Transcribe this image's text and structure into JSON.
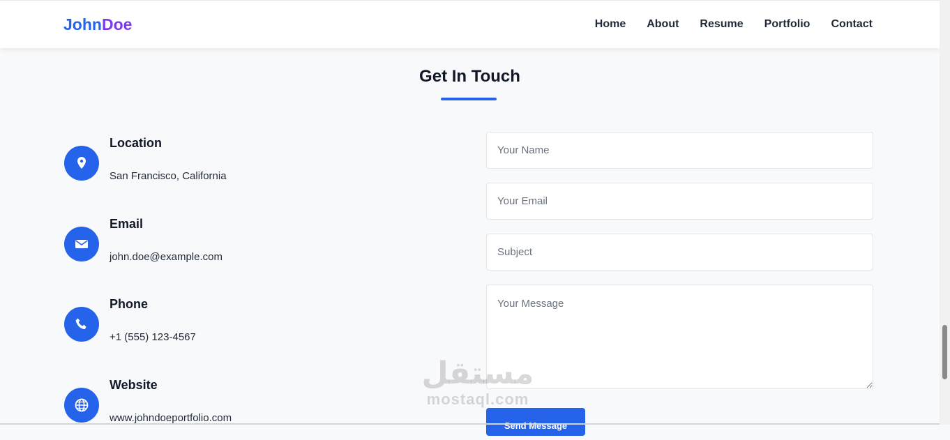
{
  "brand": {
    "first": "John",
    "last": "Doe"
  },
  "nav": {
    "home": "Home",
    "about": "About",
    "resume": "Resume",
    "portfolio": "Portfolio",
    "contact": "Contact"
  },
  "section": {
    "title": "Get In Touch"
  },
  "info": [
    {
      "label": "Location",
      "value": "San Francisco, California",
      "icon": "map-pin-icon"
    },
    {
      "label": "Email",
      "value": "john.doe@example.com",
      "icon": "envelope-icon"
    },
    {
      "label": "Phone",
      "value": "+1 (555) 123-4567",
      "icon": "phone-icon"
    },
    {
      "label": "Website",
      "value": "www.johndoeportfolio.com",
      "icon": "globe-icon"
    }
  ],
  "form": {
    "name_placeholder": "Your Name",
    "email_placeholder": "Your Email",
    "subject_placeholder": "Subject",
    "message_placeholder": "Your Message",
    "send_label": "Send Message"
  },
  "watermark": {
    "arabic": "مستقل",
    "latin": "mostaql.com"
  },
  "colors": {
    "accent": "#2563eb",
    "brand_secondary": "#7c3aed",
    "background": "#f8f9fb"
  }
}
